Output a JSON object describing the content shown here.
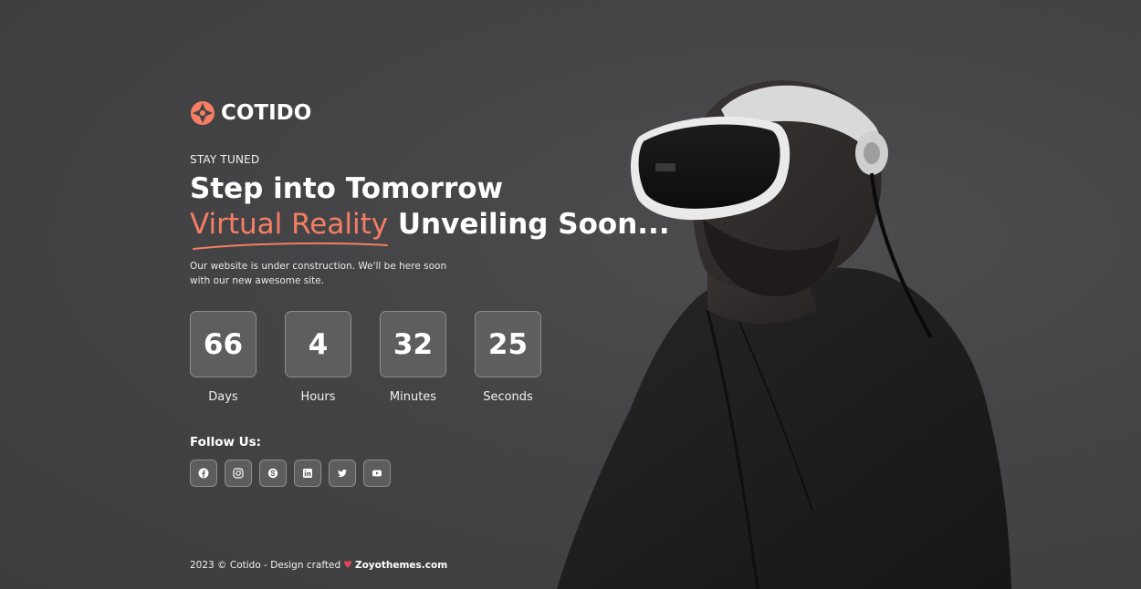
{
  "brand": {
    "name": "COTIDO",
    "accent_color": "#f57e64",
    "logo_icon": "aperture-icon"
  },
  "hero": {
    "eyebrow": "STAY TUNED",
    "headline_line1": "Step into Tomorrow",
    "headline_accent": "Virtual Reality",
    "headline_line2_rest": " Unveiling Soon...",
    "subtext": "Our website is under construction. We'll be here soon with our new awesome site."
  },
  "countdown": [
    {
      "value": "66",
      "label": "Days"
    },
    {
      "value": "4",
      "label": "Hours"
    },
    {
      "value": "32",
      "label": "Minutes"
    },
    {
      "value": "25",
      "label": "Seconds"
    }
  ],
  "social": {
    "title": "Follow Us:",
    "icons": [
      "facebook-icon",
      "instagram-icon",
      "skype-icon",
      "linkedin-icon",
      "twitter-icon",
      "youtube-icon"
    ]
  },
  "footer": {
    "text": "2023 © Cotido - Design crafted",
    "heart": "♥",
    "link": "Zoyothemes.com"
  },
  "colors": {
    "background": "#444446",
    "accent": "#f57e64",
    "heart": "#e0455a"
  }
}
